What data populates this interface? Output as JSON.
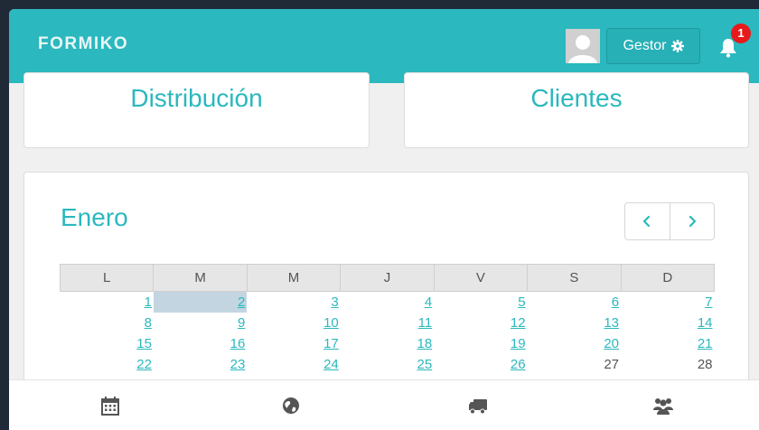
{
  "header": {
    "logo": "FORMIKO",
    "user_menu_label": "Gestor",
    "notifications_count": "1",
    "accent_color": "#2bb8be"
  },
  "cards": {
    "distribucion": "Distribución",
    "clientes": "Clientes"
  },
  "calendar": {
    "month": "Enero",
    "weekdays": [
      "L",
      "M",
      "M",
      "J",
      "V",
      "S",
      "D"
    ],
    "weeks": [
      [
        "1",
        "2",
        "3",
        "4",
        "5",
        "6",
        "7"
      ],
      [
        "8",
        "9",
        "10",
        "11",
        "12",
        "13",
        "14"
      ],
      [
        "15",
        "16",
        "17",
        "18",
        "19",
        "20",
        "21"
      ],
      [
        "22",
        "23",
        "24",
        "25",
        "26",
        "27",
        "28"
      ]
    ],
    "selected_day": "2"
  },
  "bottom_nav": {
    "items": [
      "calendar-icon",
      "globe-icon",
      "truck-icon",
      "users-icon"
    ]
  }
}
